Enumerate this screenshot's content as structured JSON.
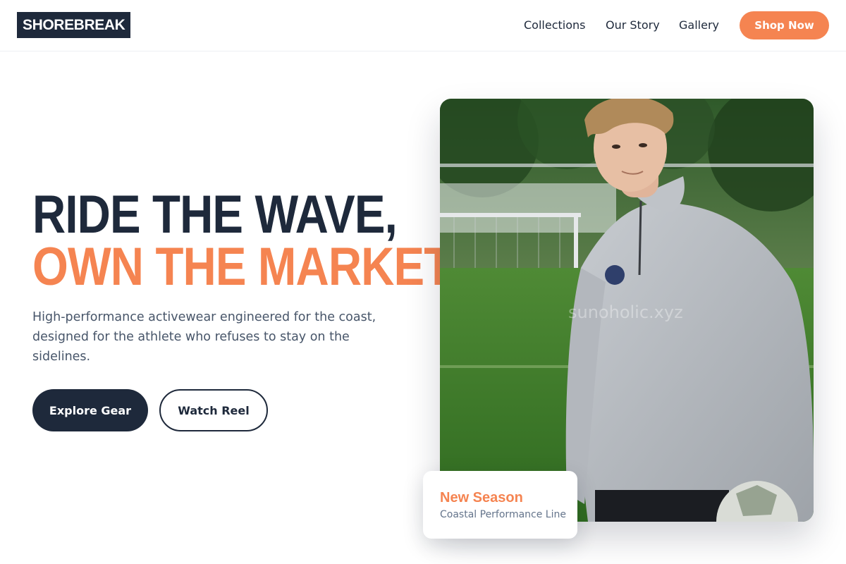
{
  "brand": {
    "logo_text": "SHOREBREAK",
    "accent": "#f58451",
    "navy": "#1e293b"
  },
  "nav": {
    "links": [
      "Collections",
      "Our Story",
      "Gallery"
    ],
    "cta_label": "Shop Now"
  },
  "hero": {
    "headline_line1": "RIDE THE WAVE,",
    "headline_line2": "OWN THE MARKET.",
    "subtitle": "High-performance activewear engineered for the coast, designed for the athlete who refuses to stay on the sidelines.",
    "primary_cta": "Explore Gear",
    "secondary_cta": "Watch Reel",
    "image_alt": "Athlete in grey quarter-zip top on a soccer field",
    "image_watermark": "sunoholic.xyz"
  },
  "badge": {
    "title": "New Season",
    "subtitle": "Coastal Performance Line"
  }
}
